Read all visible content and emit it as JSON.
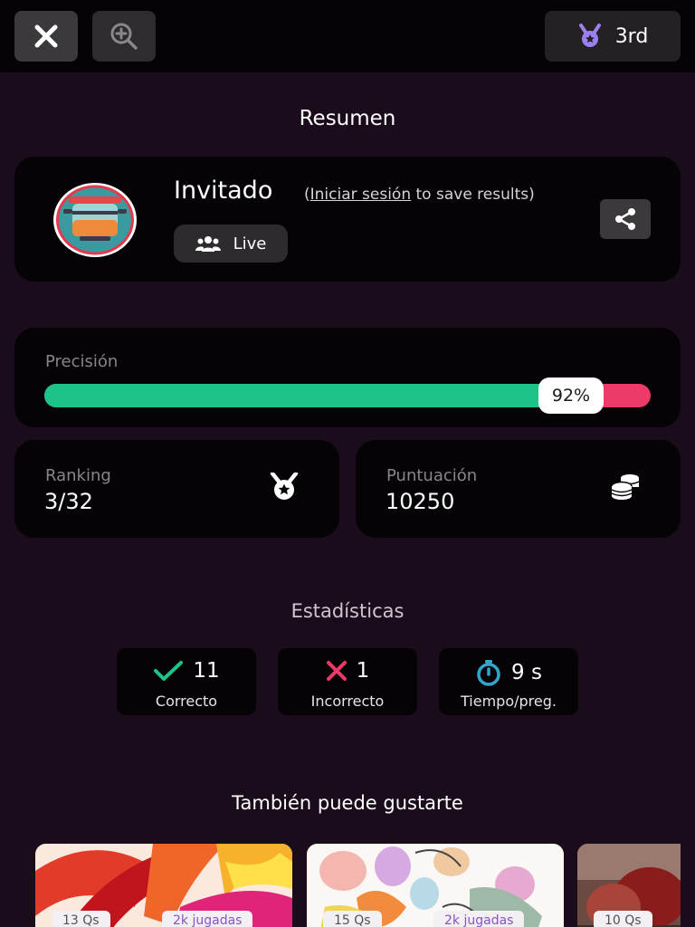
{
  "topbar": {
    "close_icon": "close-icon",
    "zoom_icon": "zoom-in-icon",
    "rank_icon": "medal-icon",
    "rank_label": "3rd"
  },
  "summary": {
    "title": "Resumen",
    "player_name": "Invitado",
    "login_prefix": "(",
    "login_link": "Iniciar sesión",
    "login_suffix": " to save results)",
    "mode_icon": "group-icon",
    "mode_label": "Live",
    "share_icon": "share-icon"
  },
  "accuracy": {
    "label": "Precisión",
    "value_label": "92%",
    "value": 0.92,
    "fill_color": "#1cc587",
    "remainder_color": "#ee3a69"
  },
  "ranking": {
    "label": "Ranking",
    "value": "3/32",
    "icon": "medal-icon"
  },
  "score": {
    "label": "Puntuación",
    "value": "10250",
    "icon": "coins-icon"
  },
  "stats": {
    "title": "Estadísticas",
    "correct": {
      "value": "11",
      "label": "Correcto",
      "icon": "check-icon",
      "color": "#1cc587"
    },
    "incorrect": {
      "value": "1",
      "label": "Incorrecto",
      "icon": "cross-icon",
      "color": "#ee3a69"
    },
    "time": {
      "value": "9 s",
      "label": "Tiempo/preg.",
      "icon": "stopwatch-icon",
      "color": "#2fa7c9"
    }
  },
  "recommendations": {
    "title": "También puede gustarte",
    "items": [
      {
        "questions": "13 Qs",
        "plays": "2k jugadas"
      },
      {
        "questions": "15 Qs",
        "plays": "2k jugadas"
      },
      {
        "questions": "10 Qs"
      }
    ]
  }
}
